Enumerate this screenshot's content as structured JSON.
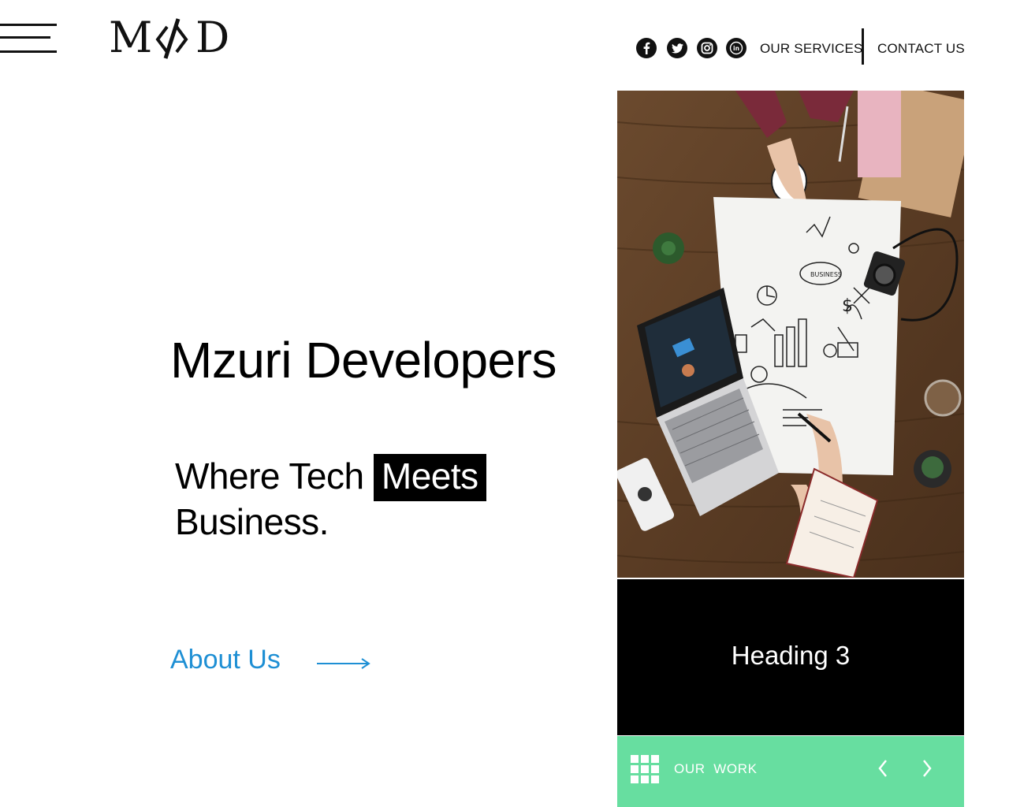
{
  "header": {
    "logo_text": "M</>D",
    "nav": {
      "services_label": "OUR SERVICES",
      "contact_label": "CONTACT US"
    },
    "social_icons": [
      "facebook-icon",
      "twitter-icon",
      "instagram-icon",
      "linkedin-icon"
    ]
  },
  "hero": {
    "title": "Mzuri Developers",
    "tagline_part1": "Where Tech ",
    "tagline_highlight": "Meets",
    "tagline_part2": "Business.",
    "cta_label": "About Us"
  },
  "card": {
    "image_alt": "Team working on business plan with laptop and sketches",
    "heading": "Heading 3",
    "footer_label": "OUR  WORK"
  },
  "colors": {
    "accent_blue": "#1e8fd4",
    "accent_green": "#67dea0",
    "text": "#111111",
    "panel": "#000000"
  }
}
